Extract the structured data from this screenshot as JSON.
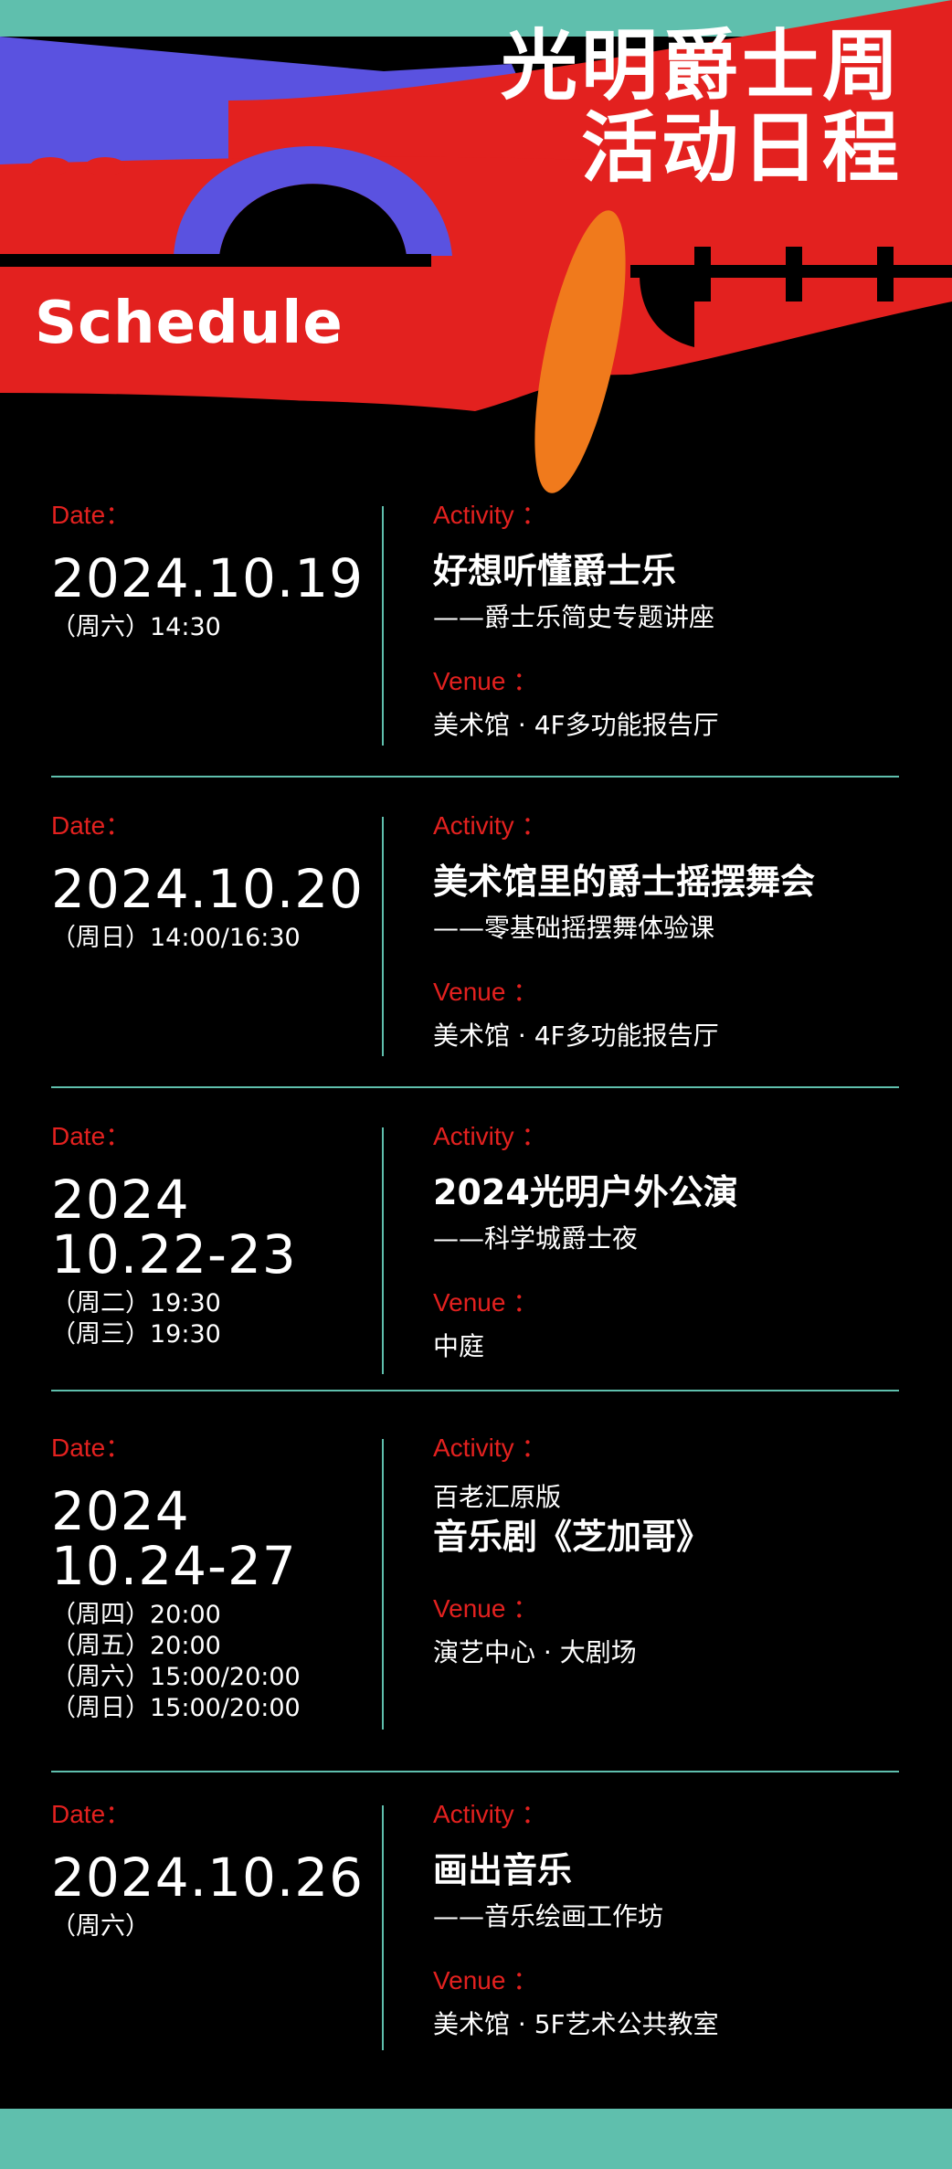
{
  "header": {
    "title_line1": "光明爵士周",
    "title_line2": "活动日程",
    "subtitle": "Schedule"
  },
  "labels": {
    "date": "Date：",
    "activity": "Activity ：",
    "venue": "Venue ："
  },
  "colors": {
    "background": "#000000",
    "accent_red": "#e3211f",
    "accent_blue": "#5a52e0",
    "accent_teal": "#5fbfad",
    "accent_orange": "#f07a1c"
  },
  "events": [
    {
      "date_lines": [
        "2024.10.19"
      ],
      "times": [
        "（周六）14:30"
      ],
      "activity_pre": "",
      "activity_title": "好想听懂爵士乐",
      "activity_sub": "——爵士乐简史专题讲座",
      "venue": "美术馆 · 4F多功能报告厅"
    },
    {
      "date_lines": [
        "2024.10.20"
      ],
      "times": [
        "（周日）14:00/16:30"
      ],
      "activity_pre": "",
      "activity_title": "美术馆里的爵士摇摆舞会",
      "activity_sub": "——零基础摇摆舞体验课",
      "venue": "美术馆 · 4F多功能报告厅"
    },
    {
      "date_lines": [
        "2024",
        "10.22-23"
      ],
      "times": [
        "（周二）19:30",
        "（周三）19:30"
      ],
      "activity_pre": "",
      "activity_title": "2024光明户外公演",
      "activity_sub": "——科学城爵士夜",
      "venue": "中庭"
    },
    {
      "date_lines": [
        "2024",
        "10.24-27"
      ],
      "times": [
        "（周四）20:00",
        "（周五）20:00",
        "（周六）15:00/20:00",
        "（周日）15:00/20:00"
      ],
      "activity_pre": "百老汇原版",
      "activity_title": "音乐剧《芝加哥》",
      "activity_sub": "",
      "venue": "演艺中心 · 大剧场"
    },
    {
      "date_lines": [
        "2024.10.26"
      ],
      "times": [
        "（周六）"
      ],
      "activity_pre": "",
      "activity_title": "画出音乐",
      "activity_sub": "——音乐绘画工作坊",
      "venue": "美术馆 · 5F艺术公共教室"
    }
  ]
}
